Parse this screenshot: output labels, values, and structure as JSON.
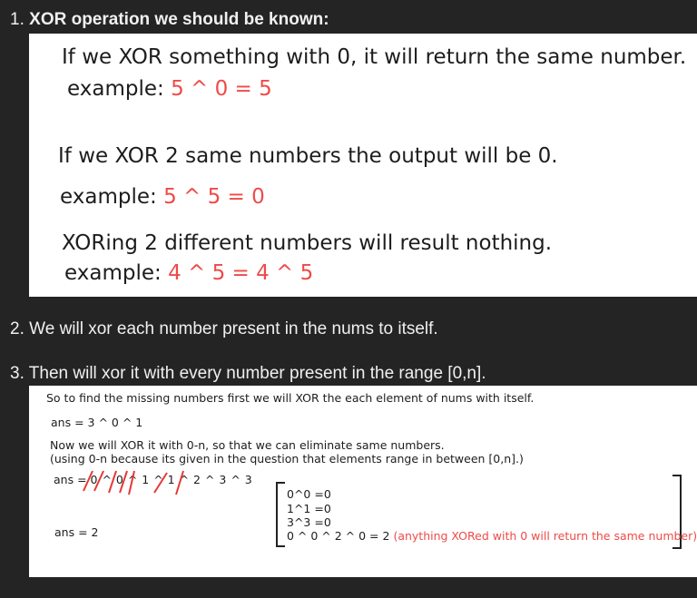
{
  "steps": [
    {
      "number": "1.",
      "text": "XOR operation we should be known:"
    },
    {
      "number": "2.",
      "text": "We will xor each number present in the nums to itself."
    },
    {
      "number": "3.",
      "text": "Then will xor it with every number present in the range [0,n]."
    }
  ],
  "panel1": {
    "rule1": "If we XOR something with 0, it will return the same number.",
    "ex1_label": "example:",
    "ex1_value": "5 ^ 0 = 5",
    "rule2": "If we XOR 2 same numbers the output will be 0.",
    "ex2_label": "example:",
    "ex2_value": "5 ^ 5 = 0",
    "rule3": "XORing 2 different numbers will result nothing.",
    "ex3_label": "example:",
    "ex3_value": "4 ^ 5 = 4 ^ 5"
  },
  "panel2": {
    "intro": "So to find the missing numbers first we will XOR the each element of nums with itself.",
    "ans1": "ans = 3 ^ 0 ^ 1",
    "now1": "Now we will XOR it with 0-n, so that we can eliminate same numbers.",
    "now2": "(using 0-n because its given in the question that elements range in between [0,n].)",
    "ans2_prefix": "ans =",
    "ans2_expr": "0 ^ 0 ^ 1 ^ 1 ^ 2 ^ 3 ^ 3",
    "ans3": "ans = 2",
    "bracket_lines": [
      "0^0 =0",
      "1^1 =0",
      "3^3 =0"
    ],
    "final_expr": "0 ^ 0 ^ 2 ^ 0 = 2",
    "final_note": "(anything XORed with 0 will return the same number)"
  }
}
